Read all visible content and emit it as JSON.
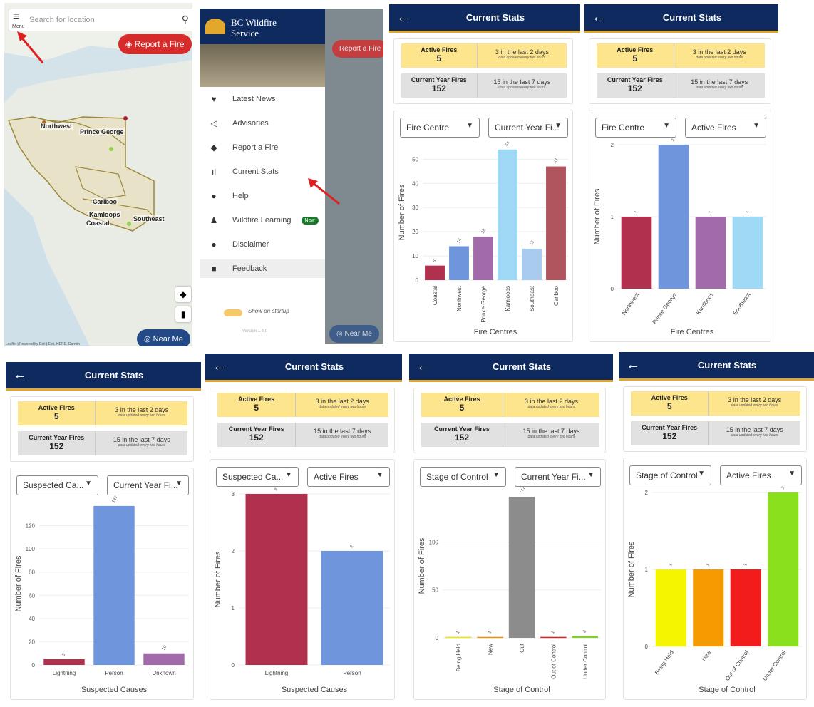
{
  "map_panel": {
    "search_placeholder": "Search for location",
    "menu_label": "Menu",
    "report_button": "Report a Fire",
    "near_me_button": "Near Me",
    "regions": [
      "Northwest",
      "Prince George",
      "Cariboo",
      "Kamloops",
      "Coastal",
      "Southeast"
    ],
    "attribution": "Leaflet | Powered by Esri | Esri, HERE, Garmin"
  },
  "nav_panel": {
    "brand_line1": "BC Wildfire",
    "brand_line2": "Service",
    "items": [
      {
        "label": "Latest News",
        "icon": "twitter-icon"
      },
      {
        "label": "Advisories",
        "icon": "megaphone-icon"
      },
      {
        "label": "Report a Fire",
        "icon": "fire-report-icon"
      },
      {
        "label": "Current Stats",
        "icon": "bar-chart-icon"
      },
      {
        "label": "Help",
        "icon": "help-icon"
      },
      {
        "label": "Wildfire Learning",
        "icon": "learning-icon",
        "badge": "New"
      },
      {
        "label": "Disclaimer",
        "icon": "info-icon"
      },
      {
        "label": "Feedback",
        "icon": "feedback-icon"
      }
    ],
    "startup_label": "Show on startup",
    "version": "Version 1.4.0",
    "report_button": "Report a Fire",
    "near_me_button": "Near Me"
  },
  "stats": {
    "title": "Current Stats",
    "active_label": "Active Fires",
    "active_value": "5",
    "active_recent": "3 in the last 2 days",
    "current_label": "Current Year Fires",
    "current_value": "152",
    "current_recent": "15 in the last 7 days",
    "updated_note": "data updated every two hours",
    "y_axis_label": "Number of Fires"
  },
  "chart_data": [
    {
      "type": "bar",
      "panel": "p3",
      "filter1": "Fire Centre",
      "filter2": "Current Year Fi...",
      "xlabel": "Fire Centres",
      "ylabel": "Number of Fires",
      "categories": [
        "Coastal",
        "Northwest",
        "Prince George",
        "Kamloops",
        "Southeast",
        "Cariboo"
      ],
      "values": [
        6,
        14,
        18,
        54,
        13,
        47
      ],
      "colors": [
        "#b0304e",
        "#6f96dc",
        "#a16ba9",
        "#9fd9f6",
        "#a9cbf0",
        "#b0545e"
      ],
      "ylim": [
        0,
        56
      ],
      "yticks": [
        0,
        10,
        20,
        30,
        40,
        50
      ],
      "label_rotation": "vertical"
    },
    {
      "type": "bar",
      "panel": "p4",
      "filter1": "Fire Centre",
      "filter2": "Active Fires",
      "xlabel": "Fire Centres",
      "ylabel": "Number of Fires",
      "categories": [
        "Northwest",
        "Prince George",
        "Kamloops",
        "Southeast"
      ],
      "values": [
        1,
        2,
        1,
        1
      ],
      "colors": [
        "#b0304e",
        "#6f96dc",
        "#a16ba9",
        "#9fd9f6"
      ],
      "ylim": [
        0,
        2
      ],
      "yticks": [
        0,
        1,
        2
      ],
      "label_rotation": "diagonal"
    },
    {
      "type": "bar",
      "panel": "p5",
      "filter1": "Suspected Ca...",
      "filter2": "Current Year Fi...",
      "xlabel": "Suspected Causes",
      "ylabel": "Number of Fires",
      "categories": [
        "Lightning",
        "Person",
        "Unknown"
      ],
      "values": [
        5,
        137,
        10
      ],
      "colors": [
        "#b0304e",
        "#6f96dc",
        "#a16ba9"
      ],
      "ylim": [
        0,
        140
      ],
      "yticks": [
        0,
        20,
        40,
        60,
        80,
        100,
        120
      ],
      "label_rotation": "none"
    },
    {
      "type": "bar",
      "panel": "p6",
      "filter1": "Suspected Ca...",
      "filter2": "Active Fires",
      "xlabel": "Suspected Causes",
      "ylabel": "Number of Fires",
      "categories": [
        "Lightning",
        "Person"
      ],
      "values": [
        3,
        2
      ],
      "colors": [
        "#b0304e",
        "#6f96dc"
      ],
      "ylim": [
        0,
        3
      ],
      "yticks": [
        0,
        1,
        2,
        3
      ],
      "label_rotation": "none"
    },
    {
      "type": "bar",
      "panel": "p7",
      "filter1": "Stage of Control",
      "filter2": "Current Year Fi...",
      "xlabel": "Stage of Control",
      "ylabel": "Number of Fires",
      "categories": [
        "Being Held",
        "New",
        "Out",
        "Out of Control",
        "Under Control"
      ],
      "values": [
        1,
        1,
        147,
        1,
        2
      ],
      "colors": [
        "#e6e600",
        "#f39200",
        "#8c8c8c",
        "#e02020",
        "#7ed321"
      ],
      "ylim": [
        0,
        150
      ],
      "yticks": [
        0,
        50,
        100
      ],
      "label_rotation": "vertical"
    },
    {
      "type": "bar",
      "panel": "p8",
      "filter1": "Stage of Control",
      "filter2": "Active Fires",
      "xlabel": "Stage of Control",
      "ylabel": "Number of Fires",
      "categories": [
        "Being Held",
        "New",
        "Out of Control",
        "Under Control"
      ],
      "values": [
        1,
        1,
        1,
        2
      ],
      "colors": [
        "#f5f500",
        "#f59a00",
        "#f21c1c",
        "#8be01e"
      ],
      "ylim": [
        0,
        2
      ],
      "yticks": [
        0,
        1,
        2
      ],
      "label_rotation": "diagonal"
    }
  ]
}
